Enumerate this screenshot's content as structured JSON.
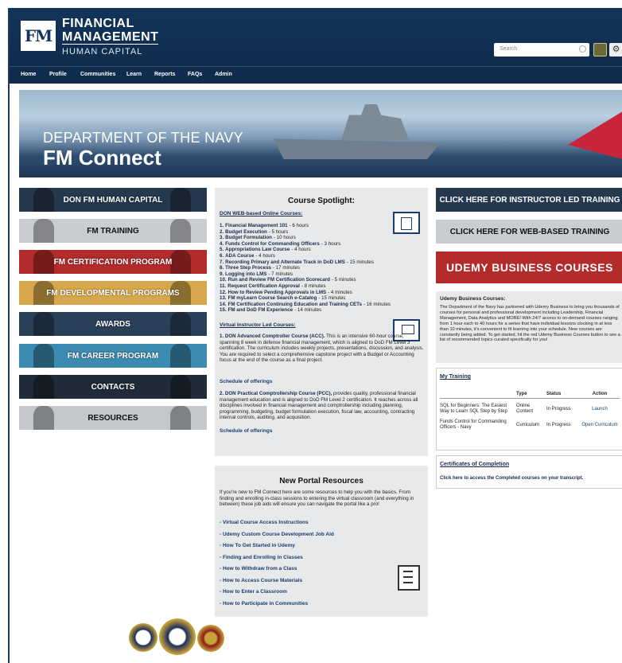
{
  "header": {
    "logo_mark": "FM",
    "logo_line1": "FINANCIAL",
    "logo_line2": "MANAGEMENT",
    "logo_line3": "HUMAN CAPITAL",
    "search_placeholder": "Search"
  },
  "nav": [
    "Home",
    "Profile",
    "Communities",
    "Learn",
    "Reports",
    "FAQs",
    "Admin"
  ],
  "banner": {
    "line1": "DEPARTMENT OF THE NAVY",
    "line2": "FM Connect"
  },
  "left_buttons": [
    {
      "label": "DON FM HUMAN CAPITAL",
      "color": "#25384e"
    },
    {
      "label": "FM TRAINING",
      "color": "#c9cdd1"
    },
    {
      "label": "FM CERTIFICATION PROGRAM",
      "color": "#b32b2b"
    },
    {
      "label": "FM DEVELOPMENTAL PROGRAMS",
      "color": "#d7a84b"
    },
    {
      "label": "AWARDS",
      "color": "#2a3f58"
    },
    {
      "label": "FM CAREER PROGRAM",
      "color": "#3c8bb0"
    },
    {
      "label": "CONTACTS",
      "color": "#1f2b38"
    },
    {
      "label": "RESOURCES",
      "color": "#c4c8cc"
    }
  ],
  "spotlight": {
    "title": "Course Spotlight:",
    "web_heading": "DON WEB-based Online Courses:",
    "courses": [
      {
        "num": "1.",
        "name": "Financial Management 101",
        "dur": "- 6 hours"
      },
      {
        "num": "2.",
        "name": "Budget Execution",
        "dur": "- 5 hours"
      },
      {
        "num": "3.",
        "name": "Budget Formulation",
        "dur": "- 10 hours"
      },
      {
        "num": "4.",
        "name": "Funds Control for Commanding Officers",
        "dur": "- 3 hours"
      },
      {
        "num": "5.",
        "name": "Appropriations Law Course",
        "dur": "- 4 hours"
      },
      {
        "num": "6.",
        "name": "ADA Course",
        "dur": "- 4 hours"
      },
      {
        "num": "7.",
        "name": "Recording Primary and Alternate Track in DoD LMS",
        "dur": "- 15 minutes"
      },
      {
        "num": "8.",
        "name": "Three Step Process",
        "dur": "- 17 minutes"
      },
      {
        "num": "9.",
        "name": "Logging into LMS",
        "dur": "- 7 minutes"
      },
      {
        "num": "10.",
        "name": "Run and Review FM Certification Scorecard",
        "dur": "- 5 minutes"
      },
      {
        "num": "11.",
        "name": "Request Certification Approval",
        "dur": "- 8 minutes"
      },
      {
        "num": "12.",
        "name": "How to Review Pending Approvals in LMS",
        "dur": "- 4 minutes"
      },
      {
        "num": "13.",
        "name": "FM myLearn Course Search e-Catalog",
        "dur": "- 15 minutes"
      },
      {
        "num": "14.",
        "name": "FM Certification Continuing Education and Training CETs",
        "dur": "- 16 minutes"
      },
      {
        "num": "15.",
        "name": "FM and DoD FM Experience",
        "dur": "- 14 minutes"
      }
    ],
    "vilt_heading": "Virtual Instructor Led Courses:",
    "acc_title": "1. DON Advanced Comptroller Course (ACC).",
    "acc_text": "This is an intensive 60-hour course, spanning 8 week in defense financial management, which is aligned to DoD FM Level 3 certification. The curriculum includes weekly projects, presentations, discussion, and analysis. You are required to select a comprehensive capstone project with a Budget or Accounting focus at the end of the course as a final project.",
    "schedule1": "Schedule of offerings",
    "pcc_title": "2. DON Practical Comptrollership Course (PCC),",
    "pcc_text": "provides quality, professional financial management education and is aligned to DoD FM Level 2 certification. It reaches across all disciplines involved in financial management and comptrollership including planning, programming, budgeting, budget formulation execution, fiscal law, accounting, contracting internal controls, auditing, and acquisition.",
    "schedule2": "Schedule of offerings"
  },
  "resources": {
    "title": "New Portal Resources",
    "intro": "If you're new to FM Connect here are some resources to help you with the basics. From finding and enrolling in-class sessions to entering the virtual classroom (and everything in between) these job aids will ensure you can navigate the portal like a pro!",
    "links": [
      "- Virtual Course Access Instructions",
      "- Udemy Custom Course Development Job Aid",
      "- How To Get Started in Udemy",
      "- Finding and Enrolling in Classes",
      "- How to Withdraw from a Class",
      "- How to Access Course Materials",
      "- How to Enter a Classroom",
      "- How to Participate in Communities"
    ]
  },
  "right": {
    "ilt_button": "CLICK HERE FOR INSTRUCTOR LED TRAINING",
    "wbt_button": "CLICK HERE FOR WEB-BASED TRAINING",
    "udemy_button": "UDEMY BUSINESS COURSES",
    "udemy_heading": "Udemy Business Courses:",
    "udemy_text": "The Department of the Navy has partnered with Udemy Business to bring you thousands of courses for personal and professional development including Leadership, Financial Management, Data Analytics and MORE! With 24/7 access to on-demand courses ranging from 1 hour each to 40 hours for a series that have individual lessons clocking in at less than 10 minutes, it's convenient to fit learning into your schedule. New courses are constantly being added. To get started, hit the red Udemy Business Courses button to see a list of recommended topics curated specifically for you!",
    "my_training_title": "My Training",
    "my_training_headers": [
      "",
      "Type",
      "Status",
      "Action"
    ],
    "my_training_rows": [
      {
        "name": "SQL for Beginners: The Easiest Way to Learn SQL Step by Step",
        "type": "Online Content",
        "status": "In Progress",
        "action": "Launch"
      },
      {
        "name": "Funds Control for Commanding Officers - Navy",
        "type": "Curriculum",
        "status": "In Progress",
        "action": "Open Curriculum"
      }
    ],
    "certs_title": "Certificates of Completion",
    "certs_text": "Click here to access the Completed courses on your transcript."
  },
  "colors": {
    "header_navy": "#13345a",
    "ilt_button": "#25384e",
    "wbt_button": "#c9cdd1",
    "udemy_button": "#b32b2b"
  }
}
